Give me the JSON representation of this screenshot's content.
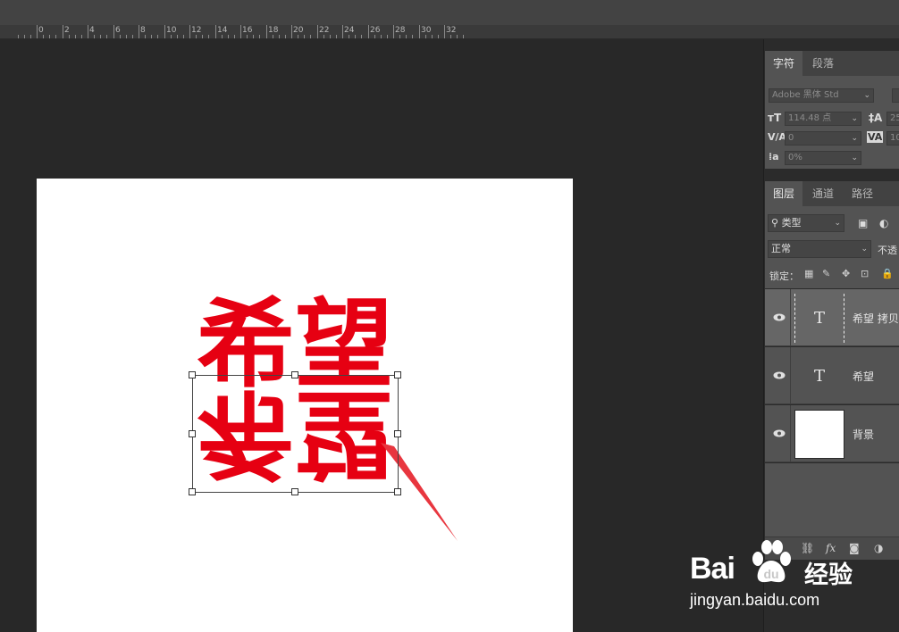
{
  "ruler": {
    "labels": [
      "0",
      "2",
      "4",
      "6",
      "8",
      "10",
      "12",
      "14",
      "16",
      "18",
      "20",
      "22",
      "24",
      "26",
      "28",
      "30",
      "32"
    ]
  },
  "character_panel": {
    "tabs": [
      "字符",
      "段落"
    ],
    "font_family": "Adobe 黑体 Std",
    "font_size": "114.48 点",
    "leading": "25",
    "kerning": "0",
    "tracking": "10",
    "tsume": "0%"
  },
  "layers_panel": {
    "tabs": [
      "图层",
      "通道",
      "路径"
    ],
    "filter_kind": "类型",
    "blend_mode": "正常",
    "opacity_label": "不透",
    "lock_label": "锁定：",
    "layers": [
      {
        "name": "希望 拷贝",
        "type": "text",
        "thumb": "T"
      },
      {
        "name": "希望",
        "type": "text",
        "thumb": "T"
      },
      {
        "name": "背景",
        "type": "image",
        "thumb": ""
      }
    ],
    "bottom_icons": [
      "link-icon",
      "fx-icon",
      "mask-icon",
      "adjustment-icon"
    ],
    "fx_label": "fx"
  },
  "canvas": {
    "text_top": "希望",
    "text_mirrored": "希望",
    "text_color": "#e60012"
  },
  "watermark": {
    "brand": "Bai",
    "brand_cn": "经验",
    "url": "jingyan.baidu.com"
  }
}
